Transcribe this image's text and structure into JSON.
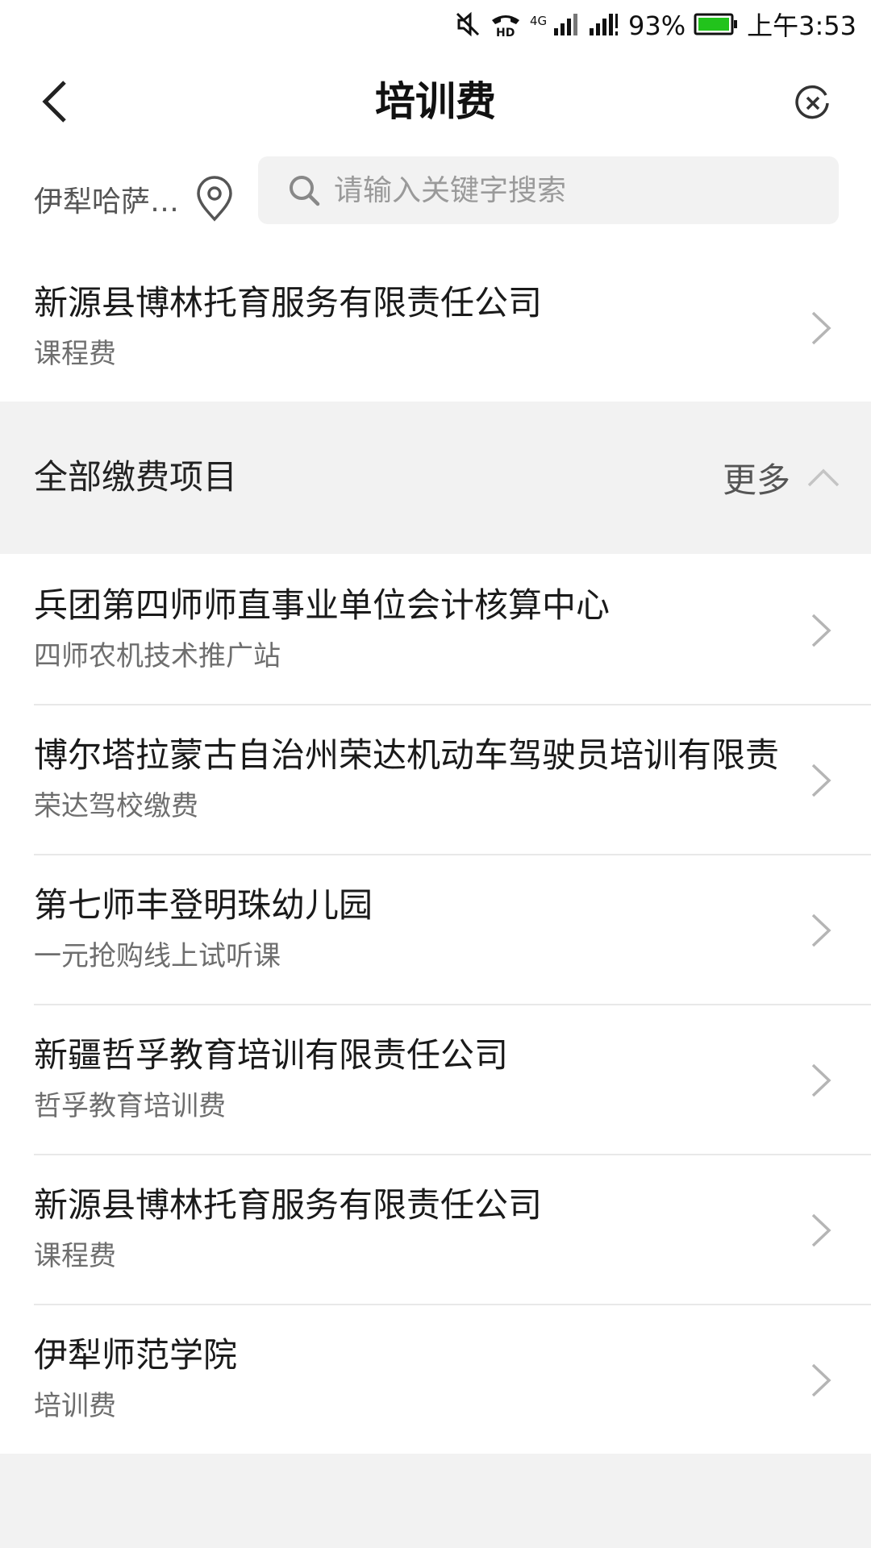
{
  "status_bar": {
    "battery": "93%",
    "time": "上午3:53",
    "net": "4G",
    "hd": "HD"
  },
  "nav": {
    "title": "培训费"
  },
  "search": {
    "location": "伊犁哈萨…",
    "placeholder": "请输入关键字搜索",
    "value": ""
  },
  "recent": [
    {
      "title": "新源县博林托育服务有限责任公司",
      "subtitle": "课程费"
    }
  ],
  "section": {
    "title": "全部缴费项目",
    "more_label": "更多"
  },
  "items": [
    {
      "title": "兵团第四师师直事业单位会计核算中心",
      "subtitle": "四师农机技术推广站"
    },
    {
      "title": "博尔塔拉蒙古自治州荣达机动车驾驶员培训有限责",
      "subtitle": "荣达驾校缴费"
    },
    {
      "title": "第七师丰登明珠幼儿园",
      "subtitle": "一元抢购线上试听课"
    },
    {
      "title": "新疆哲孚教育培训有限责任公司",
      "subtitle": "哲孚教育培训费"
    },
    {
      "title": "新源县博林托育服务有限责任公司",
      "subtitle": "课程费"
    },
    {
      "title": "伊犁师范学院",
      "subtitle": "培训费"
    }
  ],
  "colors": {
    "background": "#f2f2f2",
    "surface": "#ffffff",
    "battery_fill": "#22c31c"
  }
}
